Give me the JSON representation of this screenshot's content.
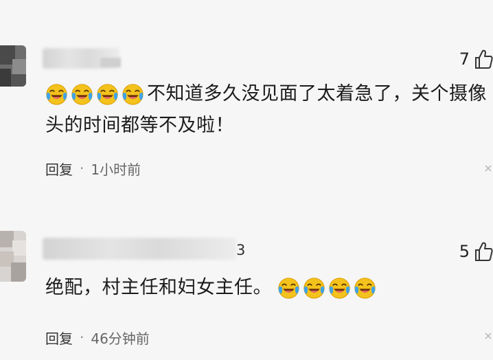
{
  "comments": [
    {
      "likes": "7",
      "text_line1": "不知道多久没见面了太着急了，关个摄像",
      "text_line2": "头的时间都等不及啦！",
      "emoji_count": 4,
      "reply_label": "回复",
      "separator": "·",
      "time": "1小时前"
    },
    {
      "username_tail": "3",
      "likes": "5",
      "text": "绝配，村主任和妇女主任。",
      "emoji_count": 4,
      "reply_label": "回复",
      "separator": "·",
      "time": "46分钟前"
    }
  ],
  "icons": {
    "emoji": "crying-laughing-emoji-icon",
    "like": "thumbs-up-icon",
    "more": "close-icon"
  },
  "colors": {
    "background": "#f6f6f6",
    "emoji_face": "#f4c21c",
    "emoji_tear": "#3ea3e8",
    "text": "#1b1b1b"
  }
}
